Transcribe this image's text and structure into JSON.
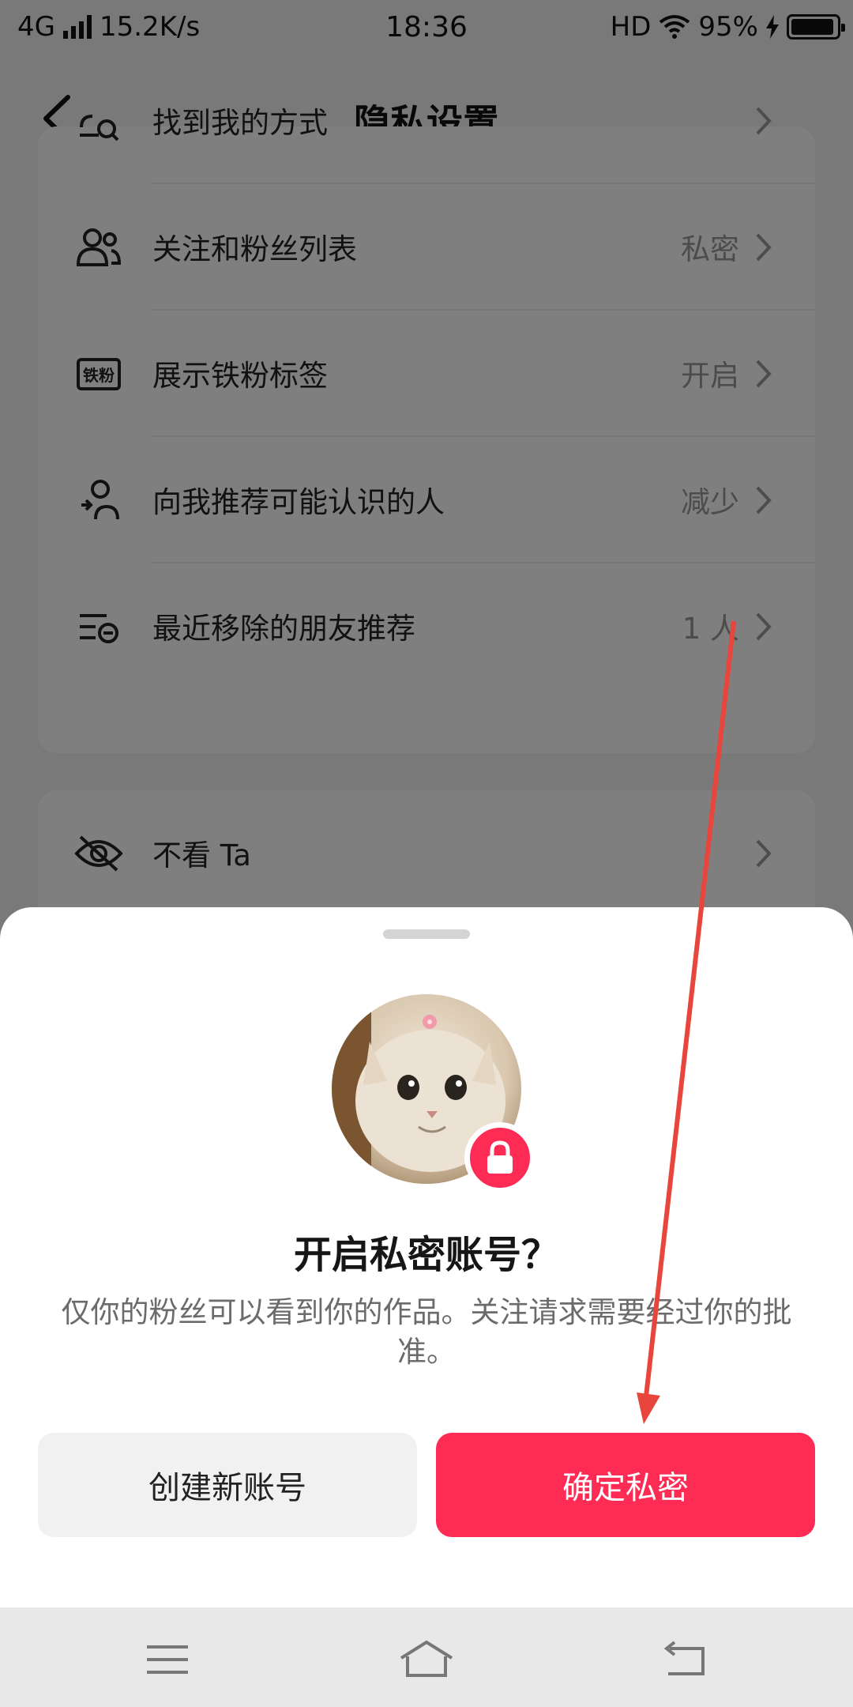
{
  "status_bar": {
    "network": "4G",
    "speed": "15.2K/s",
    "time": "18:36",
    "hd": "HD",
    "battery": "95%"
  },
  "header": {
    "title": "隐私设置"
  },
  "settings": {
    "rows": [
      {
        "label": "找到我的方式",
        "value": ""
      },
      {
        "label": "关注和粉丝列表",
        "value": "私密"
      },
      {
        "label": "展示铁粉标签",
        "value": "开启"
      },
      {
        "label": "向我推荐可能认识的人",
        "value": "减少"
      },
      {
        "label": "最近移除的朋友推荐",
        "value": "1 人"
      }
    ],
    "card2": {
      "label": "不看 Ta",
      "value": ""
    },
    "fan_badge_text": "铁粉"
  },
  "sheet": {
    "title": "开启私密账号？",
    "description": "仅你的粉丝可以看到你的作品。关注请求需要经过你的批准。",
    "secondary_button": "创建新账号",
    "primary_button": "确定私密"
  },
  "colors": {
    "accent": "#fe2c55",
    "annotation_arrow": "#e8453c"
  }
}
